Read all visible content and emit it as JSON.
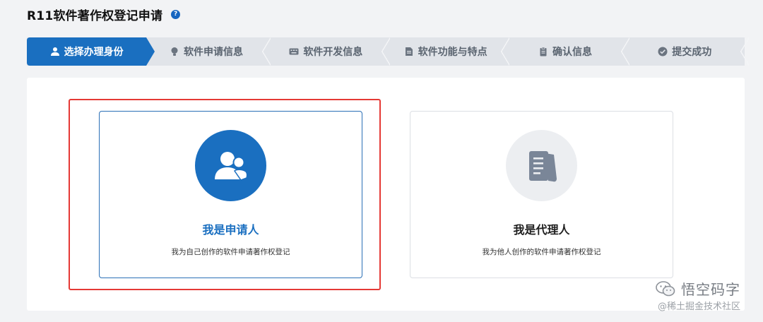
{
  "header": {
    "title": "R11软件著作权登记申请",
    "help_symbol": "?"
  },
  "steps": [
    {
      "label": "选择办理身份",
      "icon": "user-icon",
      "active": true
    },
    {
      "label": "软件申请信息",
      "icon": "bulb-icon",
      "active": false
    },
    {
      "label": "软件开发信息",
      "icon": "keyboard-icon",
      "active": false
    },
    {
      "label": "软件功能与特点",
      "icon": "document-icon",
      "active": false
    },
    {
      "label": "确认信息",
      "icon": "clipboard-icon",
      "active": false
    },
    {
      "label": "提交成功",
      "icon": "check-circle-icon",
      "active": false
    }
  ],
  "options": [
    {
      "title": "我是申请人",
      "desc": "我为自己创作的软件申请著作权登记",
      "icon": "users-icon",
      "selected": true
    },
    {
      "title": "我是代理人",
      "desc": "我为他人创作的软件申请著作权登记",
      "icon": "papers-icon",
      "selected": false
    }
  ],
  "watermark": {
    "name": "悟空码字",
    "sub": "@稀土掘金技术社区"
  },
  "colors": {
    "primary": "#1a6fc0",
    "highlight": "#e53935",
    "inactive_step": "#e1e4e9"
  }
}
